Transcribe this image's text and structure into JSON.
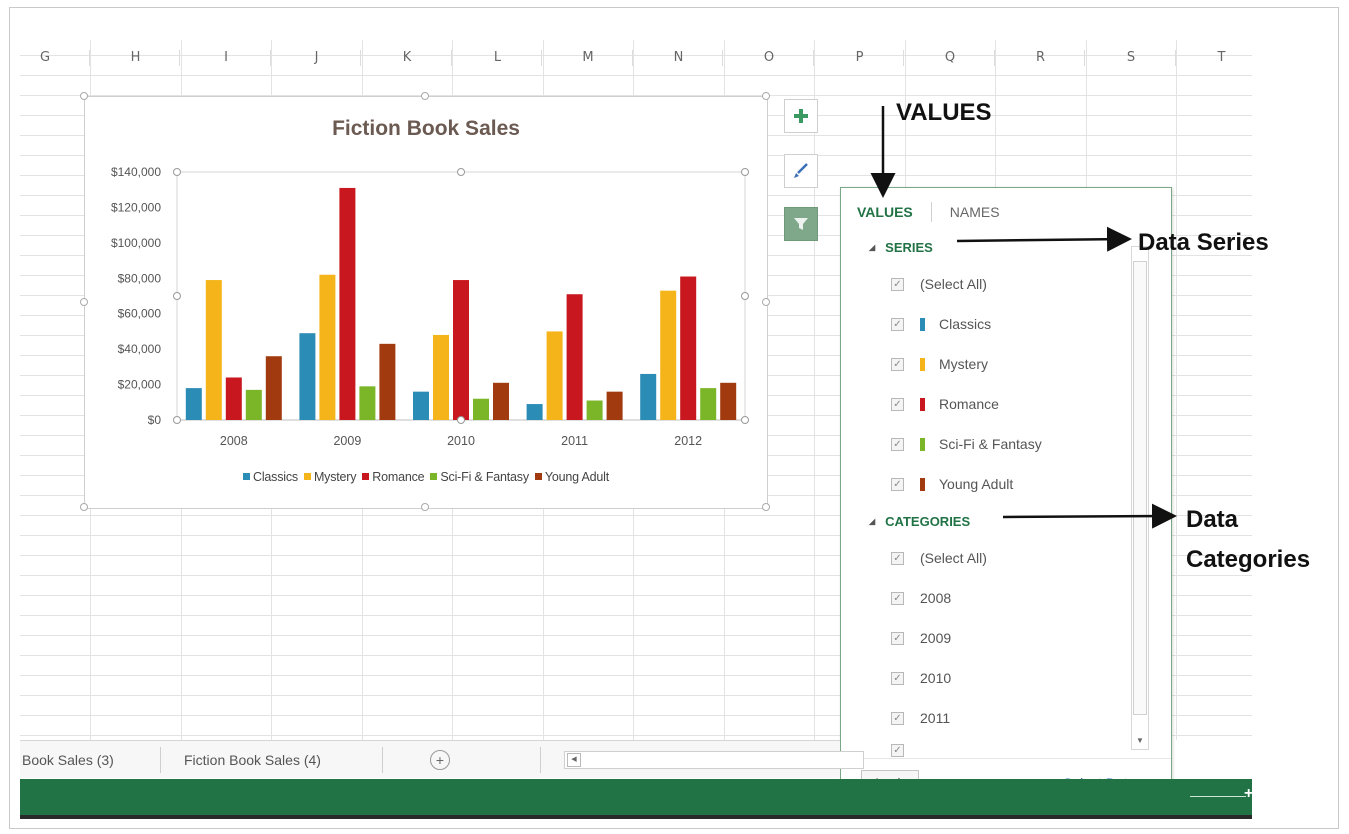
{
  "spreadsheet": {
    "columns": [
      "G",
      "H",
      "I",
      "J",
      "K",
      "L",
      "M",
      "N",
      "O",
      "P",
      "Q",
      "R",
      "S",
      "T"
    ]
  },
  "chart_data": {
    "type": "bar",
    "title": "Fiction Book Sales",
    "categories": [
      "2008",
      "2009",
      "2010",
      "2011",
      "2012"
    ],
    "series": [
      {
        "name": "Classics",
        "color": "#2b8cb6",
        "values": [
          18000,
          49000,
          16000,
          9000,
          26000
        ]
      },
      {
        "name": "Mystery",
        "color": "#f5b51a",
        "values": [
          79000,
          82000,
          48000,
          50000,
          73000
        ]
      },
      {
        "name": "Romance",
        "color": "#c8171e",
        "values": [
          24000,
          131000,
          79000,
          71000,
          81000
        ]
      },
      {
        "name": "Sci-Fi & Fantasy",
        "color": "#7bb528",
        "values": [
          17000,
          19000,
          12000,
          11000,
          18000
        ]
      },
      {
        "name": "Young Adult",
        "color": "#a23a0f",
        "values": [
          36000,
          43000,
          21000,
          16000,
          21000
        ]
      }
    ],
    "ylim": [
      0,
      140000
    ],
    "yticks": [
      "$0",
      "$20,000",
      "$40,000",
      "$60,000",
      "$80,000",
      "$100,000",
      "$120,000",
      "$140,000"
    ],
    "legend": "bottom",
    "grid": false
  },
  "side_buttons": {
    "add_icon": "plus-icon",
    "style_icon": "brush-icon",
    "filter_icon": "funnel-icon"
  },
  "filter_pane": {
    "tabs": {
      "values": "VALUES",
      "names": "NAMES"
    },
    "series_header": "SERIES",
    "series_items": [
      {
        "label": "(Select All)",
        "color": null
      },
      {
        "label": "Classics",
        "color": "#2b8cb6"
      },
      {
        "label": "Mystery",
        "color": "#f5b51a"
      },
      {
        "label": "Romance",
        "color": "#c8171e"
      },
      {
        "label": "Sci-Fi & Fantasy",
        "color": "#7bb528"
      },
      {
        "label": "Young Adult",
        "color": "#a23a0f"
      }
    ],
    "categories_header": "CATEGORIES",
    "category_items": [
      "(Select All)",
      "2008",
      "2009",
      "2010",
      "2011"
    ],
    "apply": "Apply",
    "select_data": "Select Data..."
  },
  "sheet_tabs": {
    "tab1": "Book Sales (3)",
    "tab2": "Fiction Book Sales (4)"
  },
  "annotations": {
    "values": "VALUES",
    "data_series": "Data Series",
    "data_categories_line1": "Data",
    "data_categories_line2": "Categories"
  },
  "colors": {
    "excel_green": "#217346",
    "pane_accent": "#217346"
  }
}
